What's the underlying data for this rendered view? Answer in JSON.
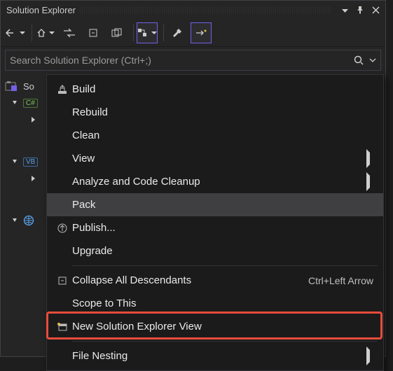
{
  "title": "Solution Explorer",
  "search": {
    "placeholder": "Search Solution Explorer (Ctrl+;)"
  },
  "tree": {
    "solution_label": "So",
    "cs_badge": "C#",
    "vb_badge": "VB"
  },
  "menu": {
    "build": "Build",
    "rebuild": "Rebuild",
    "clean": "Clean",
    "view": "View",
    "analyze": "Analyze and Code Cleanup",
    "pack": "Pack",
    "publish": "Publish...",
    "upgrade": "Upgrade",
    "collapse": "Collapse All Descendants",
    "collapse_shortcut": "Ctrl+Left Arrow",
    "scope": "Scope to This",
    "newview": "New Solution Explorer View",
    "filenesting": "File Nesting"
  }
}
